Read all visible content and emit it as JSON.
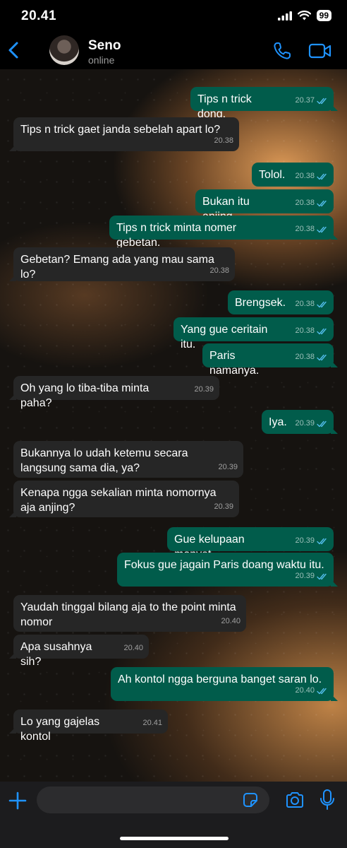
{
  "status_bar": {
    "time": "20.41",
    "battery": "99"
  },
  "header": {
    "contact_name": "Seno",
    "contact_status": "online"
  },
  "colors": {
    "accent": "#1f93ff",
    "outgoing_bubble": "#015c4b",
    "incoming_bubble": "#262626",
    "read_ticks": "#53bdeb"
  },
  "messages": [
    {
      "direction": "out",
      "text": "Tips n trick dong.",
      "time": "20.37"
    },
    {
      "direction": "in",
      "text": "Tips n trick gaet janda sebelah apart lo?",
      "time": "20.38"
    },
    {
      "direction": "out",
      "text": "Tolol.",
      "time": "20.38"
    },
    {
      "direction": "out",
      "text": "Bukan itu anjing.",
      "time": "20.38"
    },
    {
      "direction": "out",
      "text": "Tips n trick minta nomer gebetan.",
      "time": "20.38"
    },
    {
      "direction": "in",
      "text": "Gebetan? Emang ada yang mau sama lo?",
      "time": "20.38"
    },
    {
      "direction": "out",
      "text": "Brengsek.",
      "time": "20.38"
    },
    {
      "direction": "out",
      "text": "Yang gue ceritain itu.",
      "time": "20.38"
    },
    {
      "direction": "out",
      "text": "Paris namanya.",
      "time": "20.38"
    },
    {
      "direction": "in",
      "text": "Oh yang lo tiba-tiba minta paha?",
      "time": "20.39"
    },
    {
      "direction": "out",
      "text": "Iya.",
      "time": "20.39"
    },
    {
      "direction": "in",
      "text": "Bukannya lo udah ketemu secara langsung sama dia, ya?",
      "time": "20.39"
    },
    {
      "direction": "in",
      "text": "Kenapa ngga sekalian minta nomornya aja anjing?",
      "time": "20.39"
    },
    {
      "direction": "out",
      "text": "Gue kelupaan monyet.",
      "time": "20.39"
    },
    {
      "direction": "out",
      "text": "Fokus gue jagain Paris doang waktu itu.",
      "time": "20.39"
    },
    {
      "direction": "in",
      "text": "Yaudah tinggal bilang aja to the point minta nomor",
      "time": "20.40"
    },
    {
      "direction": "in",
      "text": "Apa susahnya sih?",
      "time": "20.40"
    },
    {
      "direction": "out",
      "text": "Ah kontol ngga berguna banget saran lo.",
      "time": "20.40"
    },
    {
      "direction": "in",
      "text": "Lo yang gajelas kontol",
      "time": "20.41"
    }
  ],
  "input": {
    "value": "",
    "placeholder": ""
  },
  "icons": {
    "back": "chevron-left-icon",
    "call": "phone-icon",
    "video": "video-camera-icon",
    "plus": "plus-icon",
    "sticker": "sticker-icon",
    "camera": "camera-icon",
    "mic": "microphone-icon"
  }
}
